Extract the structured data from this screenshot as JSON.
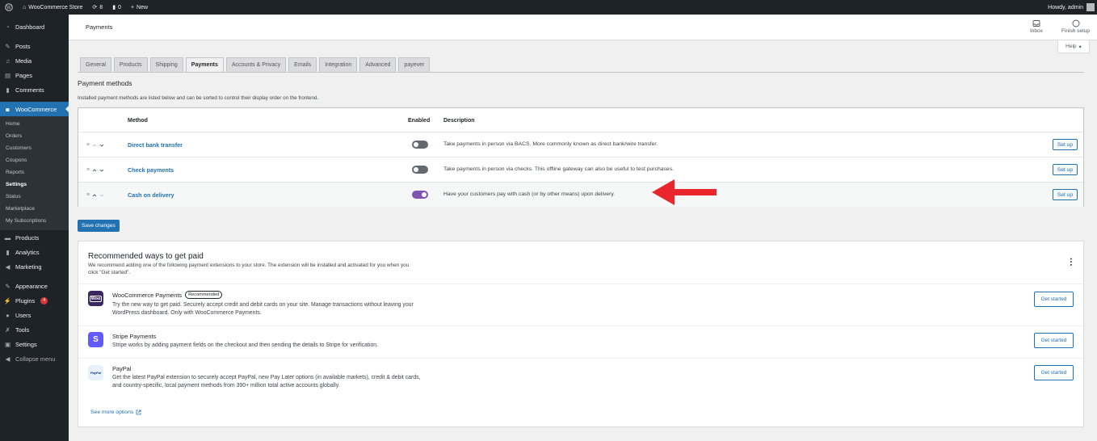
{
  "adminbar": {
    "site_name": "WooCommerce Store",
    "updates_count": "8",
    "comments_count": "0",
    "new_label": "New",
    "howdy": "Howdy, admin"
  },
  "sidebar": {
    "dashboard": "Dashboard",
    "posts": "Posts",
    "media": "Media",
    "pages": "Pages",
    "comments": "Comments",
    "woocommerce": "WooCommerce",
    "woo_sub": [
      "Home",
      "Orders",
      "Customers",
      "Coupons",
      "Reports",
      "Settings",
      "Status",
      "Marketplace",
      "My Subscriptions"
    ],
    "products": "Products",
    "analytics": "Analytics",
    "marketing": "Marketing",
    "appearance": "Appearance",
    "plugins": "Plugins",
    "plugins_badge": "4",
    "users": "Users",
    "tools": "Tools",
    "settings": "Settings",
    "collapse": "Collapse menu"
  },
  "header": {
    "title": "Payments",
    "inbox": "Inbox",
    "finish_setup": "Finish setup",
    "help": "Help"
  },
  "tabs": [
    "General",
    "Products",
    "Shipping",
    "Payments",
    "Accounts & Privacy",
    "Emails",
    "Integration",
    "Advanced",
    "payever"
  ],
  "payment_methods": {
    "title": "Payment methods",
    "description": "Installed payment methods are listed below and can be sorted to control their display order on the frontend.",
    "col_method": "Method",
    "col_enabled": "Enabled",
    "col_description": "Description",
    "rows": [
      {
        "name": "Direct bank transfer",
        "enabled": false,
        "description": "Take payments in person via BACS. More commonly known as direct bank/wire transfer.",
        "action": "Set up"
      },
      {
        "name": "Check payments",
        "enabled": false,
        "description": "Take payments in person via checks. This offline gateway can also be useful to test purchases.",
        "action": "Set up"
      },
      {
        "name": "Cash on delivery",
        "enabled": true,
        "description": "Have your customers pay with cash (or by other means) upon delivery.",
        "action": "Set up"
      }
    ],
    "save_label": "Save changes"
  },
  "recommended": {
    "title": "Recommended ways to get paid",
    "description": "We recommend adding one of the following payment extensions to your store. The extension will be installed and activated for you when you click \"Get started\".",
    "gateways": [
      {
        "name": "WooCommerce Payments",
        "badge": "Recommended",
        "logo_text": "Woo",
        "logo_color": "#3c2861",
        "description": "Try the new way to get paid. Securely accept credit and debit cards on your site. Manage transactions without leaving your WordPress dashboard. Only with WooCommerce Payments.",
        "action": "Get started"
      },
      {
        "name": "Stripe Payments",
        "logo_text": "S",
        "logo_color": "#635bff",
        "description": "Stripe works by adding payment fields on the checkout and then sending the details to Stripe for verification.",
        "action": "Get started"
      },
      {
        "name": "PayPal",
        "logo_text": "PayPal",
        "logo_color": "#e8f1fb",
        "description": "Get the latest PayPal extension to securely accept PayPal, new Pay Later options (in available markets), credit & debit cards, and country-specific, local payment methods from 390+ million total active accounts globally.",
        "action": "Get started"
      }
    ],
    "see_more": "See more options"
  },
  "colors": {
    "accent": "#2271b1",
    "toggle_on": "#7f54b3",
    "annotation_arrow": "#e8262b"
  }
}
